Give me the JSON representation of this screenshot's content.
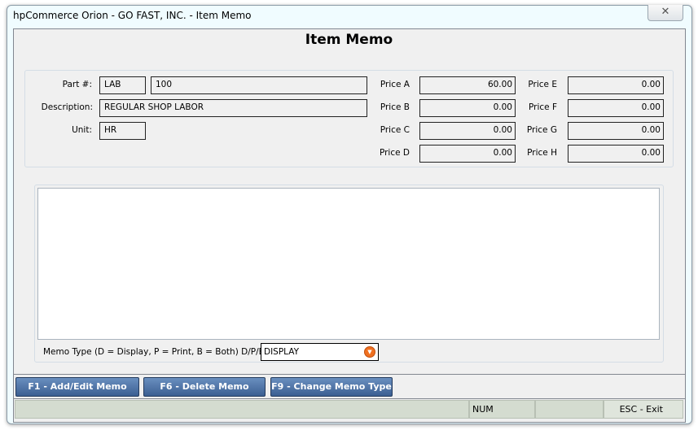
{
  "window": {
    "title": "hpCommerce Orion - GO FAST, INC. - Item Memo",
    "close_icon": "close-icon"
  },
  "heading": "Item Memo",
  "item": {
    "part_label": "Part #:",
    "part_prefix": "LAB",
    "part_number": "100",
    "description_label": "Description:",
    "description": "REGULAR SHOP LABOR",
    "unit_label": "Unit:",
    "unit": "HR"
  },
  "prices": [
    {
      "label": "Price A",
      "value": "60.00"
    },
    {
      "label": "Price B",
      "value": "0.00"
    },
    {
      "label": "Price C",
      "value": "0.00"
    },
    {
      "label": "Price D",
      "value": "0.00"
    },
    {
      "label": "Price E",
      "value": "0.00"
    },
    {
      "label": "Price F",
      "value": "0.00"
    },
    {
      "label": "Price G",
      "value": "0.00"
    },
    {
      "label": "Price H",
      "value": "0.00"
    }
  ],
  "memo": {
    "text": "",
    "type_label": "Memo Type (D = Display, P = Print, B = Both) D/P/B:",
    "type_value": "DISPLAY",
    "accent": "#f07020"
  },
  "buttons": {
    "add_edit": "F1 - Add/Edit Memo",
    "delete": "F6 - Delete Memo",
    "change_type": "F9 - Change Memo Type"
  },
  "status": {
    "seg1": "",
    "num": "NUM",
    "seg3": "",
    "exit": "ESC - Exit"
  }
}
